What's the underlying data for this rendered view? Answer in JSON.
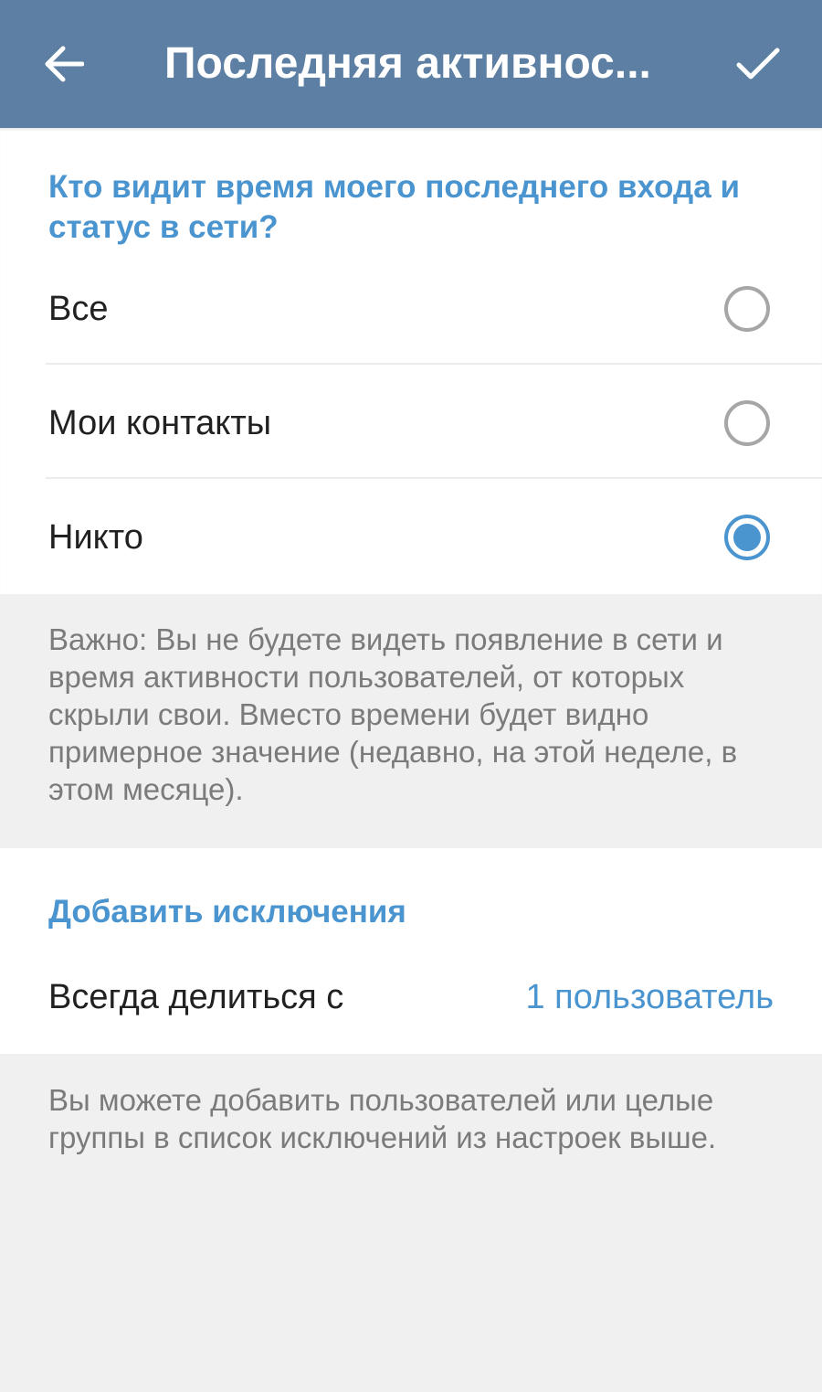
{
  "header": {
    "title": "Последняя активнос..."
  },
  "privacy": {
    "question": "Кто видит время моего последнего входа и статус в сети?",
    "options": [
      {
        "label": "Все",
        "selected": false
      },
      {
        "label": "Мои контакты",
        "selected": false
      },
      {
        "label": "Никто",
        "selected": true
      }
    ],
    "note": "Важно: Вы не будете видеть появление в сети и время активности пользователей, от которых скрыли свои. Вместо времени будет видно примерное значение (недавно, на этой неделе, в этом месяце)."
  },
  "exceptions": {
    "header": "Добавить исключения",
    "always_share_label": "Всегда делиться с",
    "always_share_value": "1 пользователь",
    "note": "Вы можете добавить пользователей или целые группы в список исключений из настроек выше."
  },
  "colors": {
    "toolbar": "#5d7fa3",
    "accent": "#4a94cf",
    "background": "#f0f0f0"
  }
}
